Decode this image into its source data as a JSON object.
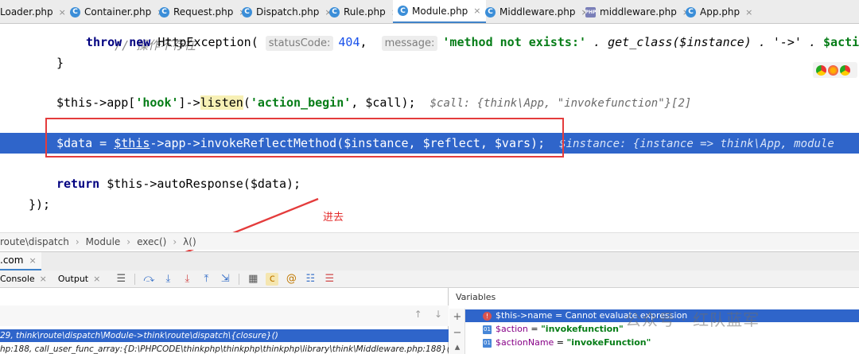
{
  "tabs": [
    {
      "label": "Loader.php",
      "icon": "class-icon",
      "active": false
    },
    {
      "label": "Container.php",
      "icon": "class-icon",
      "active": false
    },
    {
      "label": "Request.php",
      "icon": "class-icon",
      "active": false
    },
    {
      "label": "Dispatch.php",
      "icon": "class-icon",
      "active": false
    },
    {
      "label": "Rule.php",
      "icon": "class-icon",
      "active": false
    },
    {
      "label": "Module.php",
      "icon": "class-icon",
      "active": true
    },
    {
      "label": "Middleware.php",
      "icon": "class-icon",
      "active": false
    },
    {
      "label": "middleware.php",
      "icon": "php-file-icon",
      "active": false
    },
    {
      "label": "App.php",
      "icon": "class-icon",
      "active": false
    }
  ],
  "code": {
    "line_comment": "// 操作不存在",
    "line_throw": {
      "kw_throw": "throw",
      "kw_new": "new",
      "cls": "HttpException(",
      "hint1": "statusCode:",
      "arg1": "404",
      "comma1": ",",
      "hint2": "message:",
      "arg2": "'method not exists:'",
      "rest": " . get_class($instance) . '->' .",
      "tail": "$acti"
    },
    "line_close_brace": "}",
    "line_listen": {
      "pre": "$this->app[",
      "key": "'hook'",
      "mid": "]->",
      "method": "listen",
      "paren": "(",
      "arg": "'action_begin'",
      "post": ", $call);",
      "inline": "$call: {think\\App, \"invokefunction\"}[2]"
    },
    "line_exec": {
      "pre": "$data = ",
      "this": "$this",
      "post": "->app->invokeReflectMethod($instance, $reflect, $vars);",
      "inline": "$instance: {instance => think\\App, module"
    },
    "line_return": {
      "kw": "return",
      "post": " $this->autoResponse($data);"
    },
    "line_end": "});"
  },
  "annotation": "进去",
  "breadcrumb": [
    "route\\dispatch",
    "Module",
    "exec()",
    "λ()"
  ],
  "debug": {
    "session_tab": ".com",
    "console_tab": "Console",
    "output_tab": "Output",
    "frames": {
      "selected": "29, think\\route\\dispatch\\Module->think\\route\\dispatch\\{closure}()",
      "next": "hp:188, call_user_func_array:{D:\\PHPCODE\\thinkphp\\thinkphp\\thinkphp\\library\\think\\Middleware.php:188}()"
    },
    "variables_title": "Variables",
    "variables": [
      {
        "name": "$this->name",
        "value": " = Cannot evaluate expression",
        "badge": "error-icon",
        "selected": true
      },
      {
        "name": "$action",
        "value": "\"invokefunction\"",
        "badge": "field-icon",
        "selected": false
      },
      {
        "name": "$actionName",
        "value": "\"invokeFunction\"",
        "badge": "field-icon",
        "selected": false
      }
    ]
  },
  "watermark": "公众号 · 红队蓝军",
  "colors": {
    "execution_line": "#2f65ca",
    "annotation": "#e43c3c",
    "active_tab_underline": "#4083c9"
  }
}
